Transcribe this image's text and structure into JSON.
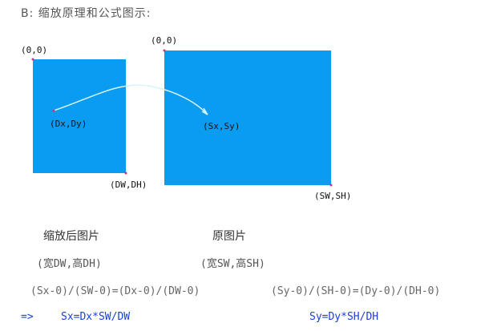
{
  "heading": "B: 缩放原理和公式图示:",
  "left_box": {
    "origin_label": "(0,0)",
    "point_label": "(Dx,Dy)",
    "corner_label": "(DW,DH)",
    "caption": "缩放后图片",
    "subcaption": "(宽DW,高DH)"
  },
  "right_box": {
    "origin_label": "(0,0)",
    "point_label": "(Sx,Sy)",
    "corner_label": "(SW,SH)",
    "caption": "原图片",
    "subcaption": "(宽SW,高SH)"
  },
  "colors": {
    "box_fill": "#0a9cf0",
    "arrow": "#d8f4fb",
    "dot": "#e0306a",
    "result_text": "#1a3fd8"
  },
  "formulas": {
    "x_ratio": "(Sx-0)/(SW-0)=(Dx-0)/(DW-0)",
    "y_ratio": "(Sy-0)/(SH-0)=(Dy-0)/(DH-0)"
  },
  "results": {
    "arrow_symbol": "=>",
    "x_result": "Sx=Dx*SW/DW",
    "y_result": "Sy=Dy*SH/DH"
  }
}
